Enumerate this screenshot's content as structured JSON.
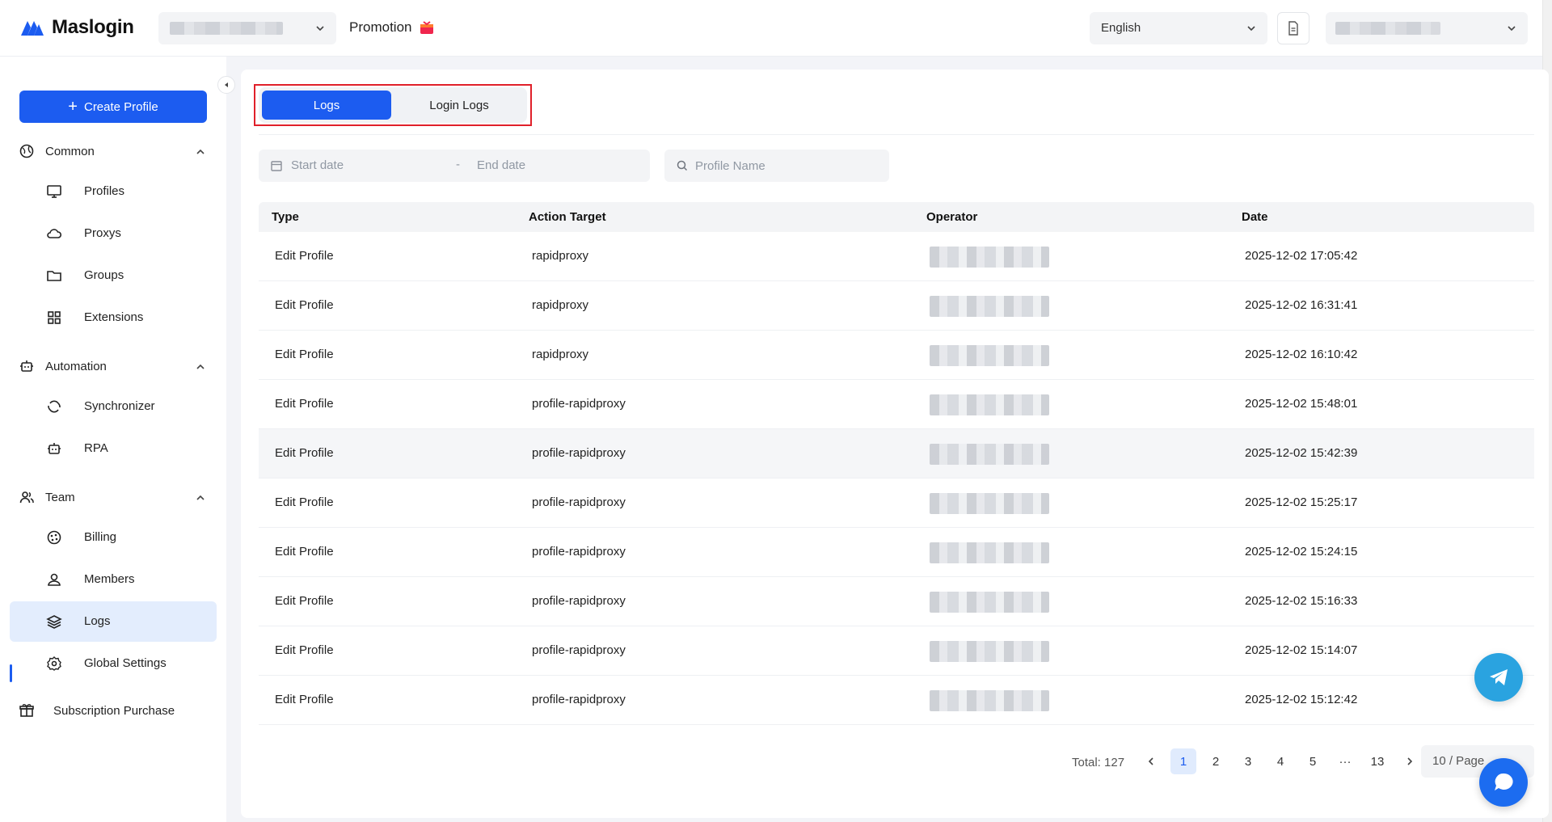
{
  "brand": {
    "name": "Maslogin",
    "accent": "#1c5cf0"
  },
  "header": {
    "promotion_label": "Promotion",
    "language": "English"
  },
  "sidebar": {
    "create_label": "Create Profile",
    "groups": [
      {
        "label": "Common",
        "icon": "globe-icon"
      },
      {
        "label": "Automation",
        "icon": "robot-icon"
      },
      {
        "label": "Team",
        "icon": "team-icon"
      }
    ],
    "items": [
      {
        "label": "Profiles",
        "icon": "monitor-icon"
      },
      {
        "label": "Proxys",
        "icon": "cloud-icon"
      },
      {
        "label": "Groups",
        "icon": "folder-icon"
      },
      {
        "label": "Extensions",
        "icon": "grid-icon"
      },
      {
        "label": "Synchronizer",
        "icon": "sync-icon"
      },
      {
        "label": "RPA",
        "icon": "robot-icon"
      },
      {
        "label": "Billing",
        "icon": "billing-icon"
      },
      {
        "label": "Members",
        "icon": "user-icon"
      },
      {
        "label": "Logs",
        "icon": "layers-icon"
      },
      {
        "label": "Global Settings",
        "icon": "gear-icon"
      }
    ],
    "subscription_label": "Subscription Purchase"
  },
  "tabs": {
    "logs": "Logs",
    "login_logs": "Login Logs"
  },
  "filters": {
    "start_placeholder": "Start date",
    "separator": "-",
    "end_placeholder": "End date",
    "search_placeholder": "Profile Name"
  },
  "table": {
    "headers": {
      "type": "Type",
      "target": "Action Target",
      "operator": "Operator",
      "date": "Date"
    },
    "rows": [
      {
        "type": "Edit Profile",
        "target": "rapidproxy",
        "date": "2025-12-02 17:05:42"
      },
      {
        "type": "Edit Profile",
        "target": "rapidproxy",
        "date": "2025-12-02 16:31:41"
      },
      {
        "type": "Edit Profile",
        "target": "rapidproxy",
        "date": "2025-12-02 16:10:42"
      },
      {
        "type": "Edit Profile",
        "target": "profile-rapidproxy",
        "date": "2025-12-02 15:48:01"
      },
      {
        "type": "Edit Profile",
        "target": "profile-rapidproxy",
        "date": "2025-12-02 15:42:39"
      },
      {
        "type": "Edit Profile",
        "target": "profile-rapidproxy",
        "date": "2025-12-02 15:25:17"
      },
      {
        "type": "Edit Profile",
        "target": "profile-rapidproxy",
        "date": "2025-12-02 15:24:15"
      },
      {
        "type": "Edit Profile",
        "target": "profile-rapidproxy",
        "date": "2025-12-02 15:16:33"
      },
      {
        "type": "Edit Profile",
        "target": "profile-rapidproxy",
        "date": "2025-12-02 15:14:07"
      },
      {
        "type": "Edit Profile",
        "target": "profile-rapidproxy",
        "date": "2025-12-02 15:12:42"
      }
    ]
  },
  "pagination": {
    "total": "Total: 127",
    "pages": [
      "1",
      "2",
      "3",
      "4",
      "5",
      "···",
      "13"
    ],
    "current": "1",
    "page_size": "10 / Page"
  }
}
